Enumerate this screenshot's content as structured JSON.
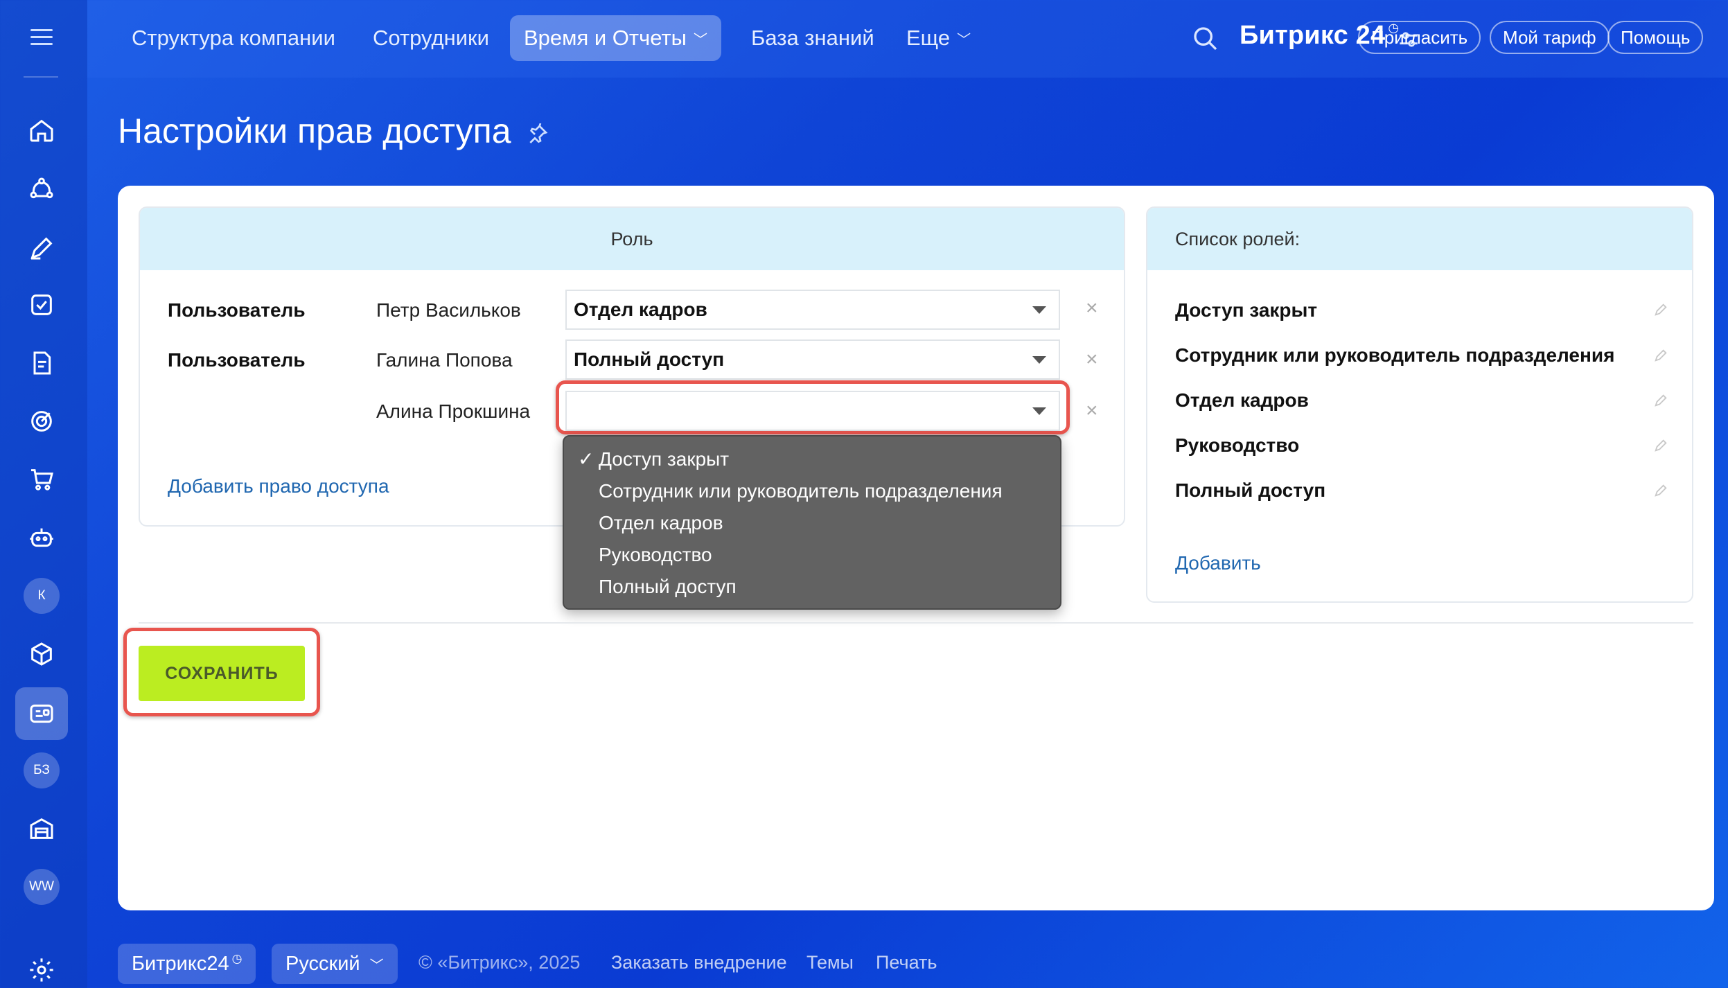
{
  "nav": {
    "items": [
      {
        "label": "Структура компании"
      },
      {
        "label": "Сотрудники"
      },
      {
        "label": "Время и Отчеты"
      },
      {
        "label": "База знаний"
      },
      {
        "label": "Еще"
      }
    ],
    "brand": "Битрикс 24",
    "buttons": {
      "invite": "Пригласить",
      "tariff": "Мой тариф",
      "help": "Помощь"
    }
  },
  "sidebar": {
    "bubbles": {
      "k": "К",
      "bz": "БЗ",
      "ww": "WW"
    }
  },
  "page": {
    "title": "Настройки прав доступа"
  },
  "roles_panel": {
    "header": "Роль",
    "rows": [
      {
        "label": "Пользователь",
        "name": "Петр Васильков",
        "selected": "Отдел кадров"
      },
      {
        "label": "Пользователь",
        "name": "Галина Попова",
        "selected": "Полный доступ"
      },
      {
        "label": "",
        "name": "Алина Прокшина",
        "selected": ""
      }
    ],
    "add_link": "Добавить право доступа",
    "remove_symbol": "×"
  },
  "dropdown": {
    "check": "✓",
    "options": [
      "Доступ закрыт",
      "Сотрудник или руководитель подразделения",
      "Отдел кадров",
      "Руководство",
      "Полный доступ"
    ]
  },
  "role_list": {
    "header": "Список ролей:",
    "items": [
      "Доступ закрыт",
      "Сотрудник или руководитель подразделения",
      "Отдел кадров",
      "Руководство",
      "Полный доступ"
    ],
    "add_link": "Добавить"
  },
  "save_label": "СОХРАНИТЬ",
  "footer": {
    "brand": "Битрикс24",
    "language": "Русский",
    "copyright": "© «Битрикс», 2025",
    "order": "Заказать внедрение",
    "themes": "Темы",
    "print": "Печать"
  },
  "colors": {
    "accent": "#bbed21",
    "highlight": "#e8554e",
    "link": "#2067b0",
    "header_bg": "#d8f1fb"
  }
}
